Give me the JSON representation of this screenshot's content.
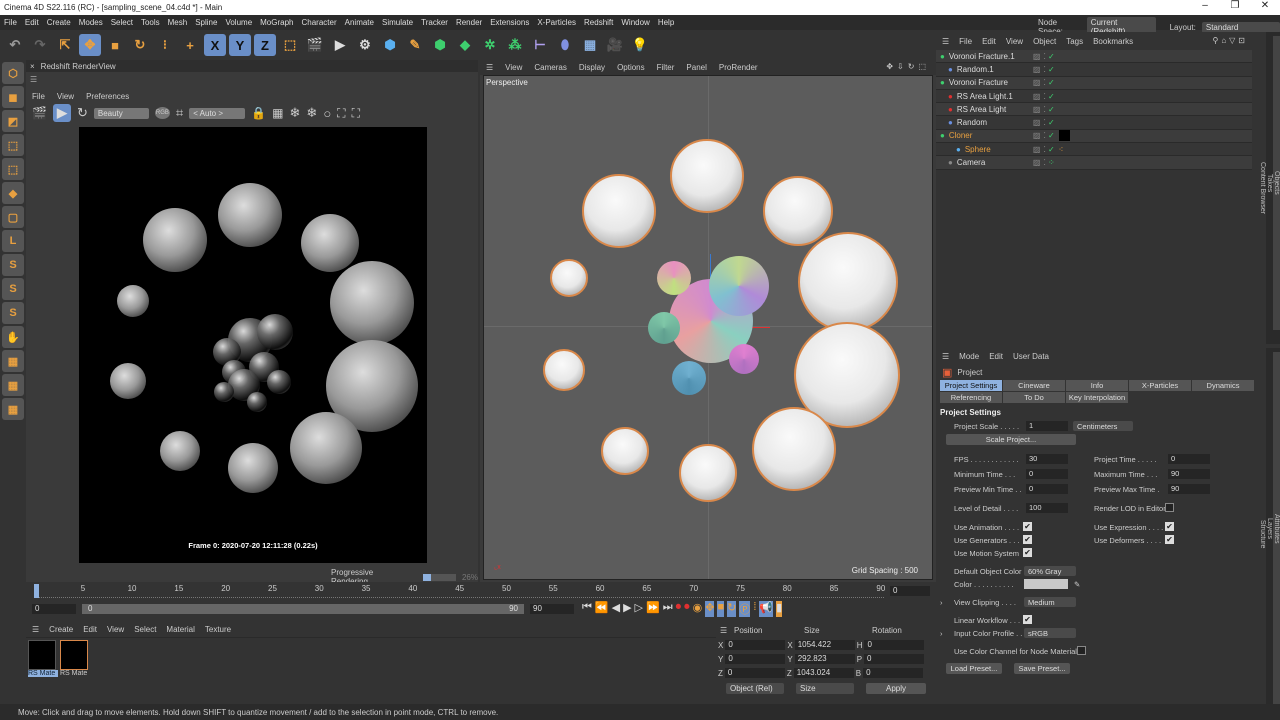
{
  "window": {
    "title": "Cinema 4D S22.116 (RC) - [sampling_scene_04.c4d *] - Main",
    "minimize": "–",
    "maximize": "❐",
    "close": "✕"
  },
  "menu": [
    "File",
    "Edit",
    "Create",
    "Modes",
    "Select",
    "Tools",
    "Mesh",
    "Spline",
    "Volume",
    "MoGraph",
    "Character",
    "Animate",
    "Simulate",
    "Tracker",
    "Render",
    "Extensions",
    "X-Particles",
    "Redshift",
    "Window",
    "Help"
  ],
  "node_space": {
    "label": "Node Space:",
    "value": "Current (Redshift)"
  },
  "layout": {
    "label": "Layout:",
    "value": "Standard"
  },
  "toolbar": {
    "x": "X",
    "y": "Y",
    "z": "Z"
  },
  "renderview": {
    "title": "Redshift RenderView",
    "menu": [
      "File",
      "View",
      "Preferences"
    ],
    "aov": "Beauty",
    "rgb": "RGB",
    "crop": "< Auto >",
    "frame_info": "Frame 0:  2020-07-20  12:11:28  (0.22s)",
    "progress_label": "Progressive Rendering...",
    "progress_pct": "26%",
    "progress": 0.26
  },
  "viewport": {
    "menu": [
      "View",
      "Cameras",
      "Display",
      "Options",
      "Filter",
      "Panel",
      "ProRender"
    ],
    "name": "Perspective",
    "grid": "Grid Spacing : 500"
  },
  "objects": {
    "menu": [
      "File",
      "Edit",
      "View",
      "Object",
      "Tags",
      "Bookmarks"
    ],
    "items": [
      {
        "name": "Voronoi Fracture.1",
        "color": "#3ecf6e"
      },
      {
        "name": "Random.1",
        "color": "#6a8fe0"
      },
      {
        "name": "Voronoi Fracture",
        "color": "#3ecf6e"
      },
      {
        "name": "RS Area Light.1",
        "color": "#e03030"
      },
      {
        "name": "RS Area Light",
        "color": "#e03030"
      },
      {
        "name": "Random",
        "color": "#6a8fe0"
      },
      {
        "name": "Cloner",
        "color": "#3ecf6e",
        "label_color": "#e8a040"
      },
      {
        "name": "Sphere",
        "color": "#5ab0f0",
        "label_color": "#e8a040"
      },
      {
        "name": "Camera",
        "color": "#888"
      }
    ],
    "side_tabs": [
      "Objects",
      "Takes",
      "Content Browser"
    ]
  },
  "attributes": {
    "menu": [
      "Mode",
      "Edit",
      "User Data"
    ],
    "object": "Project",
    "tabs": [
      "Project Settings",
      "Cineware",
      "Info",
      "X-Particles",
      "Dynamics",
      "Referencing",
      "To Do",
      "Key Interpolation"
    ],
    "section": "Project Settings",
    "project_scale_label": "Project Scale . . . . .",
    "project_scale": "1",
    "units": "Centimeters",
    "scale_btn": "Scale Project...",
    "fps_label": "FPS . . . . . . . . . . . .",
    "fps": "30",
    "project_time_label": "Project Time . . . . .",
    "project_time": "0",
    "min_time_label": "Minimum Time . . .",
    "min_time": "0",
    "max_time_label": "Maximum Time . . .",
    "max_time": "90",
    "prev_min_label": "Preview Min Time . .",
    "prev_min": "0",
    "prev_max_label": "Preview Max Time .",
    "prev_max": "90",
    "lod_label": "Level of Detail . . . .",
    "lod": "100",
    "render_lod_label": "Render LOD in Editor",
    "use_anim": "Use Animation . . . .",
    "use_expr": "Use Expression . . . .",
    "use_gen": "Use Generators . . .",
    "use_def": "Use Deformers . . . .",
    "use_motion": "Use Motion System",
    "def_color_label": "Default Object Color",
    "def_color": "60% Gray",
    "color_label": "Color . . . . . . . . . .",
    "color_swatch": "#c8c8c8",
    "clip_label": "View Clipping . . . .",
    "clip": "Medium",
    "linear_label": "Linear Workflow . . .",
    "profile_label": "Input Color Profile . .",
    "profile": "sRGB",
    "node_mat_label": "Use Color Channel for Node Material",
    "load": "Load Preset...",
    "save": "Save Preset...",
    "side_tabs": [
      "Attributes",
      "Layers",
      "Structure"
    ]
  },
  "timeline": {
    "ticks": [
      "0",
      "5",
      "10",
      "15",
      "20",
      "25",
      "30",
      "35",
      "40",
      "45",
      "50",
      "55",
      "60",
      "65",
      "70",
      "75",
      "80",
      "85",
      "90"
    ],
    "current": "0",
    "start": "0",
    "range_start": "0",
    "range_end": "90",
    "end": "90"
  },
  "materials": {
    "menu": [
      "Create",
      "Edit",
      "View",
      "Select",
      "Material",
      "Texture"
    ],
    "items": [
      "RS Mate",
      "RS Mate"
    ]
  },
  "coords": {
    "headers": [
      "Position",
      "Size",
      "Rotation"
    ],
    "rows": [
      {
        "a": "X",
        "p": "0",
        "s": "1054.422",
        "r": "H",
        "rv": "0"
      },
      {
        "a": "Y",
        "p": "0",
        "s": "292.823",
        "r": "P",
        "rv": "0"
      },
      {
        "a": "Z",
        "p": "0",
        "s": "1043.024",
        "r": "B",
        "rv": "0"
      }
    ],
    "mode": "Object (Rel)",
    "size_mode": "Size",
    "apply": "Apply"
  },
  "status": "Move: Click and drag to move elements. Hold down SHIFT to quantize movement / add to the selection in point mode, CTRL to remove."
}
